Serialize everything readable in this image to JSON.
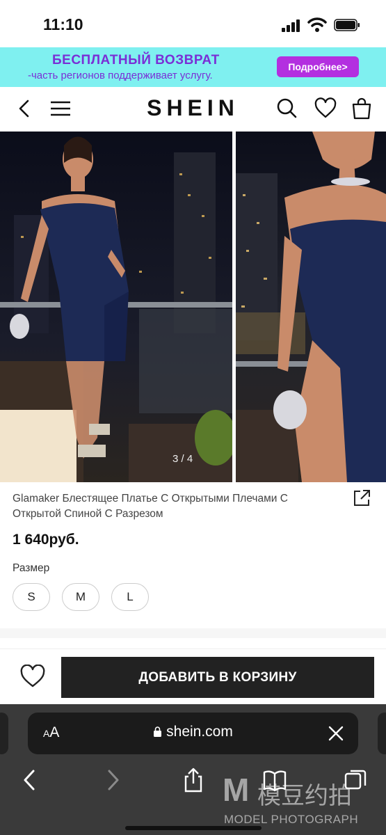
{
  "status_bar": {
    "time": "11:10"
  },
  "promo": {
    "title": "БЕСПЛАТНЫЙ ВОЗВРАТ",
    "subtitle": "-часть регионов поддерживает услугу.",
    "button": "Подробнее>"
  },
  "header": {
    "logo": "SHEIN"
  },
  "gallery": {
    "counter": "3 / 4"
  },
  "product": {
    "title": "Glamaker Блестящее Платье С Открытыми Плечами С Открытой Спиной С Разрезом",
    "price": "1 640руб.",
    "size_label": "Размер",
    "sizes": [
      "S",
      "M",
      "L"
    ]
  },
  "cart": {
    "add_button": "ДОБАВИТЬ В КОРЗИНУ"
  },
  "browser": {
    "aa_small": "A",
    "aa_big": "A",
    "url": "shein.com"
  },
  "watermark": {
    "letter": "M",
    "chinese": "模豆约拍",
    "english": "MODEL PHOTOGRAPH"
  },
  "colors": {
    "promo_bg": "#7ff0f0",
    "promo_text": "#7a2fd6",
    "promo_button": "#b32fe0",
    "cart_button": "#222222",
    "browser_bg": "#3a3a3a"
  }
}
